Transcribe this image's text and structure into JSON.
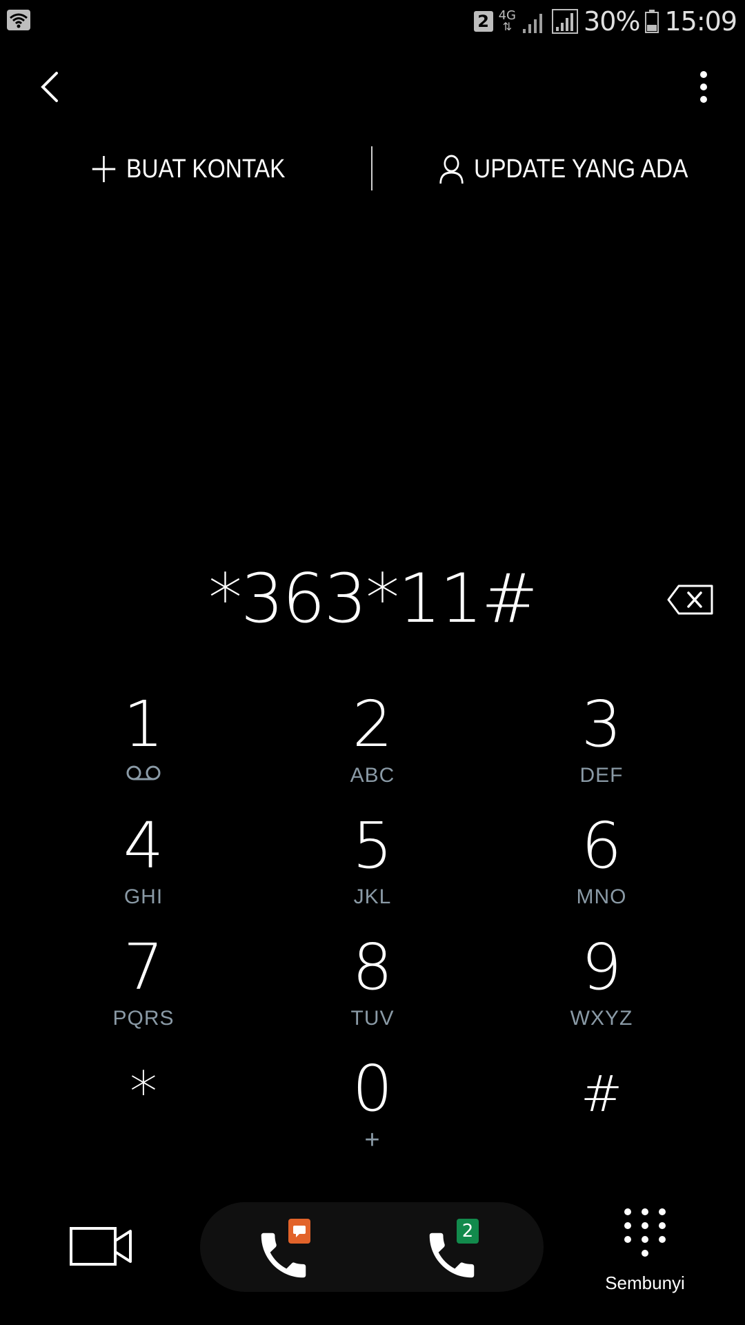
{
  "status_bar": {
    "sim_number": "2",
    "network_type": "4G",
    "battery": "30%",
    "time": "15:09",
    "icons": [
      "wifi-icon",
      "sim-badge",
      "data-arrows-icon",
      "signal-icon",
      "battery-icon"
    ]
  },
  "nav": {
    "back_icon": "chevron-left-icon",
    "more_icon": "more-vertical-icon"
  },
  "actions": {
    "create_contact": "BUAT KONTAK",
    "update_existing": "UPDATE YANG ADA"
  },
  "dialer": {
    "number": "*363*11#"
  },
  "keypad": {
    "keys": [
      {
        "digit": "1",
        "letters": ""
      },
      {
        "digit": "2",
        "letters": "ABC"
      },
      {
        "digit": "3",
        "letters": "DEF"
      },
      {
        "digit": "4",
        "letters": "GHI"
      },
      {
        "digit": "5",
        "letters": "JKL"
      },
      {
        "digit": "6",
        "letters": "MNO"
      },
      {
        "digit": "7",
        "letters": "PQRS"
      },
      {
        "digit": "8",
        "letters": "TUV"
      },
      {
        "digit": "9",
        "letters": "WXYZ"
      },
      {
        "digit": "*",
        "letters": ""
      },
      {
        "digit": "0",
        "letters": "+"
      },
      {
        "digit": "#",
        "letters": ""
      }
    ]
  },
  "bottom_bar": {
    "sim2_label": "2",
    "hide_label": "Sembunyi"
  },
  "colors": {
    "background": "#000000",
    "letters": "#8a9aa6",
    "sim1_accent": "#e2632a",
    "sim2_accent": "#128a4c"
  }
}
